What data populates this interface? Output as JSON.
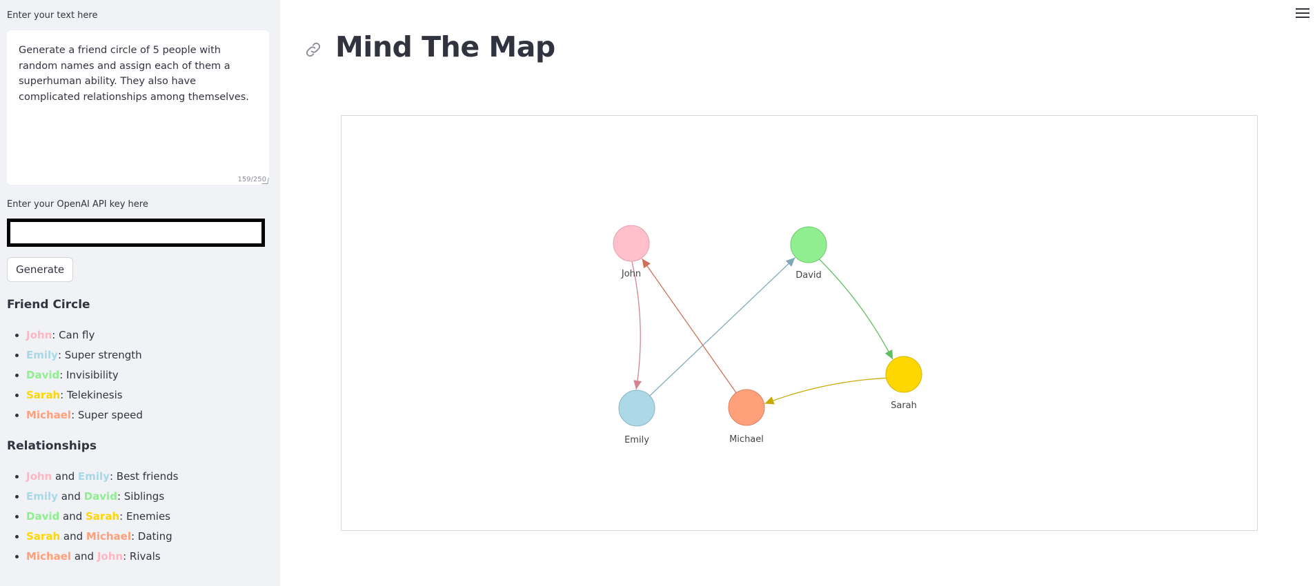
{
  "sidebar": {
    "text_label": "Enter your text here",
    "text_value": "Generate a friend circle of 5 people with random names and assign each of them a superhuman ability. They also have complicated relationships among themselves.",
    "char_count": "159/250",
    "api_label": "Enter your OpenAI API key here",
    "api_value": "",
    "generate_label": "Generate",
    "friend_circle_title": "Friend Circle",
    "friends": [
      {
        "name": "John",
        "color": "#ffb6c1",
        "ability": ": Can fly"
      },
      {
        "name": "Emily",
        "color": "#a8d8e6",
        "ability": ": Super strength"
      },
      {
        "name": "David",
        "color": "#90ee90",
        "ability": ": Invisibility"
      },
      {
        "name": "Sarah",
        "color": "#ffd700",
        "ability": ": Telekinesis"
      },
      {
        "name": "Michael",
        "color": "#ffa07a",
        "ability": ": Super speed"
      }
    ],
    "relationships_title": "Relationships",
    "relationships": [
      {
        "a": "John",
        "a_color": "#ffb6c1",
        "and": " and ",
        "b": "Emily",
        "b_color": "#a8d8e6",
        "rel": ": Best friends"
      },
      {
        "a": "Emily",
        "a_color": "#a8d8e6",
        "and": " and ",
        "b": "David",
        "b_color": "#90ee90",
        "rel": ": Siblings"
      },
      {
        "a": "David",
        "a_color": "#90ee90",
        "and": " and ",
        "b": "Sarah",
        "b_color": "#ffd700",
        "rel": ": Enemies"
      },
      {
        "a": "Sarah",
        "a_color": "#ffd700",
        "and": " and ",
        "b": "Michael",
        "b_color": "#ffa07a",
        "rel": ": Dating"
      },
      {
        "a": "Michael",
        "a_color": "#ffa07a",
        "and": " and ",
        "b": "John",
        "b_color": "#ffb6c1",
        "rel": ": Rivals"
      }
    ]
  },
  "main": {
    "title": "Mind The Map",
    "icons": {
      "anchor": "link-icon",
      "menu": "hamburger-menu-icon"
    }
  },
  "graph": {
    "nodes": [
      {
        "id": "John",
        "label": "John",
        "color": "#ffc0cb",
        "stroke": "#e0a0ab"
      },
      {
        "id": "David",
        "label": "David",
        "color": "#90ee90",
        "stroke": "#6cc96c"
      },
      {
        "id": "Sarah",
        "label": "Sarah",
        "color": "#ffd700",
        "stroke": "#d8b400"
      },
      {
        "id": "Emily",
        "label": "Emily",
        "color": "#add8e6",
        "stroke": "#86b6c6"
      },
      {
        "id": "Michael",
        "label": "Michael",
        "color": "#ffa07a",
        "stroke": "#d98060"
      }
    ],
    "edges": [
      {
        "from": "John",
        "to": "Emily",
        "color": "#d4838f"
      },
      {
        "from": "Emily",
        "to": "David",
        "color": "#7fa7b8"
      },
      {
        "from": "David",
        "to": "Sarah",
        "color": "#5fbf5f"
      },
      {
        "from": "Sarah",
        "to": "Michael",
        "color": "#c9a800"
      },
      {
        "from": "Michael",
        "to": "John",
        "color": "#d0705a"
      }
    ]
  }
}
